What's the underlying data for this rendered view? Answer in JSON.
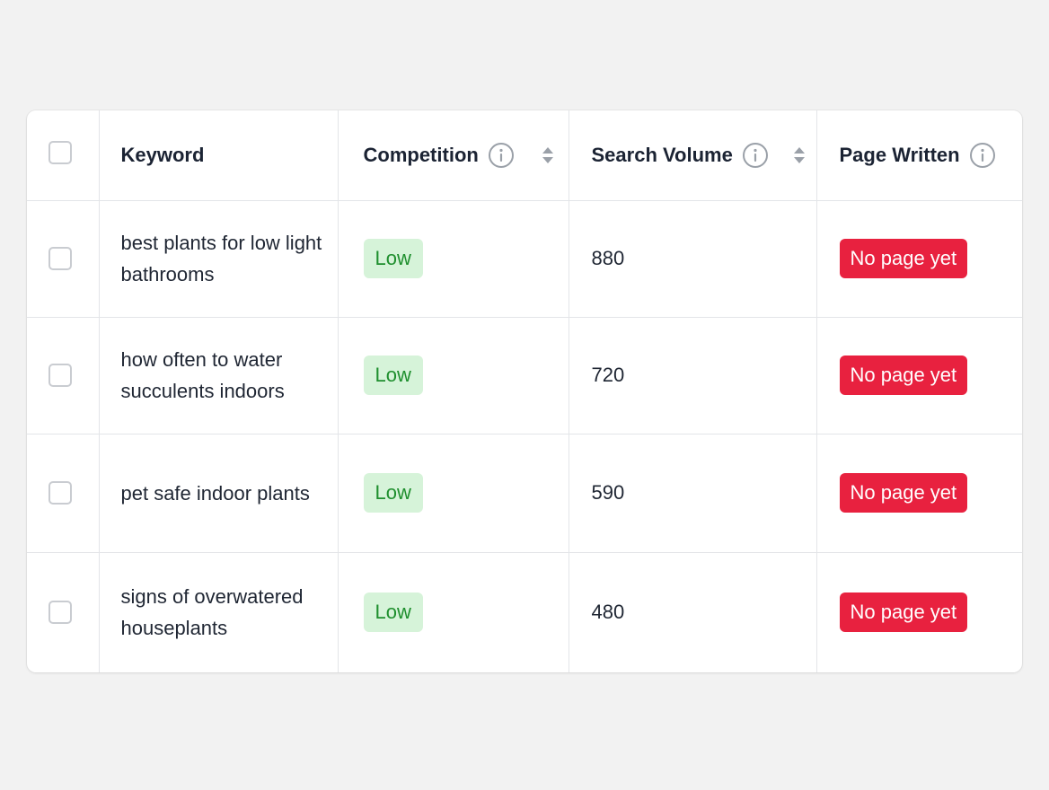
{
  "columns": {
    "keyword": "Keyword",
    "competition": "Competition",
    "search_volume": "Search Volume",
    "page_written": "Page Written"
  },
  "icons": {
    "info": "info-icon",
    "sort": "sort-icon"
  },
  "colors": {
    "low_badge_bg": "#d6f3d9",
    "low_badge_text": "#1f8f2e",
    "no_page_badge_bg": "#e8213f",
    "no_page_badge_text": "#ffffff"
  },
  "rows": [
    {
      "keyword": "best plants for low light bathrooms",
      "competition": "Low",
      "search_volume": "880",
      "page_status": "No page yet",
      "selected": false
    },
    {
      "keyword": "how often to water succulents indoors",
      "competition": "Low",
      "search_volume": "720",
      "page_status": "No page yet",
      "selected": false
    },
    {
      "keyword": "pet safe indoor plants",
      "competition": "Low",
      "search_volume": "590",
      "page_status": "No page yet",
      "selected": false
    },
    {
      "keyword": "signs of overwatered houseplants",
      "competition": "Low",
      "search_volume": "480",
      "page_status": "No page yet",
      "selected": false
    }
  ]
}
